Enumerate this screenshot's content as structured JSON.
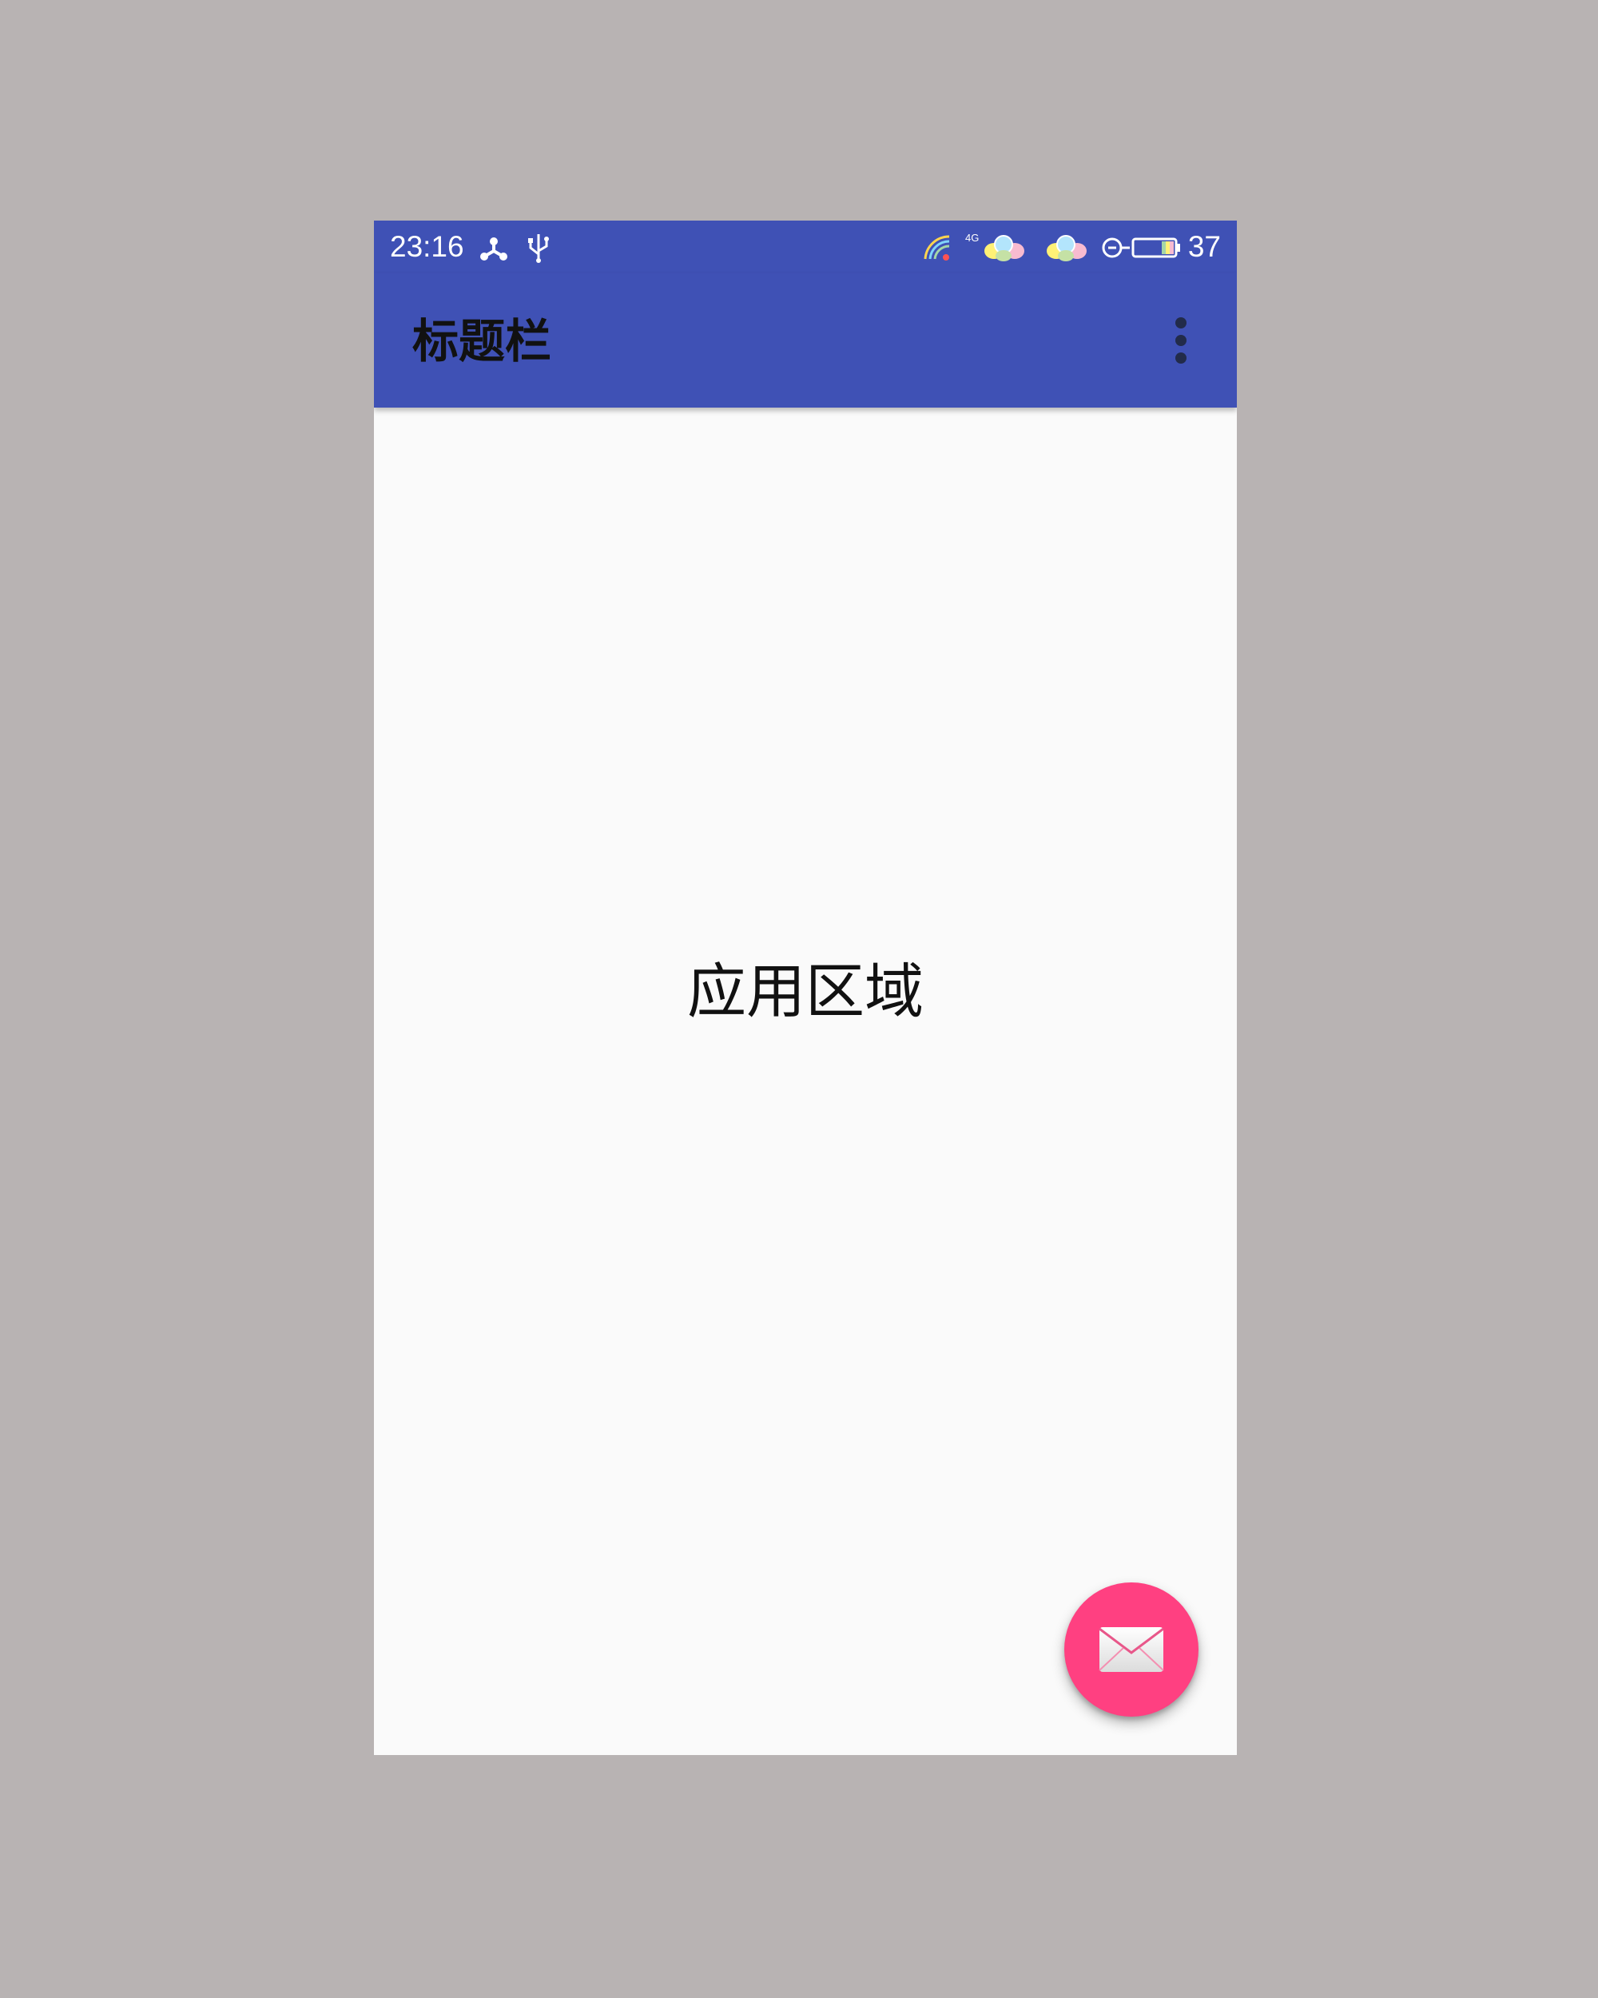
{
  "status_bar": {
    "time": "23:16",
    "battery_level": "37",
    "network_label": "4G",
    "icons": [
      "share-icon",
      "usb-icon",
      "wifi-icon",
      "network-4g-icon",
      "balloon-icon",
      "balloon-icon",
      "charging-icon",
      "battery-icon"
    ]
  },
  "app_bar": {
    "title": "标题栏",
    "overflow_icon": "more-vert-icon"
  },
  "content": {
    "label": "应用区域"
  },
  "fab": {
    "icon": "mail-icon"
  },
  "colors": {
    "primary": "#3f51b5",
    "accent": "#ff4081",
    "background": "#fafafa",
    "outer": "#b8b3b3"
  }
}
